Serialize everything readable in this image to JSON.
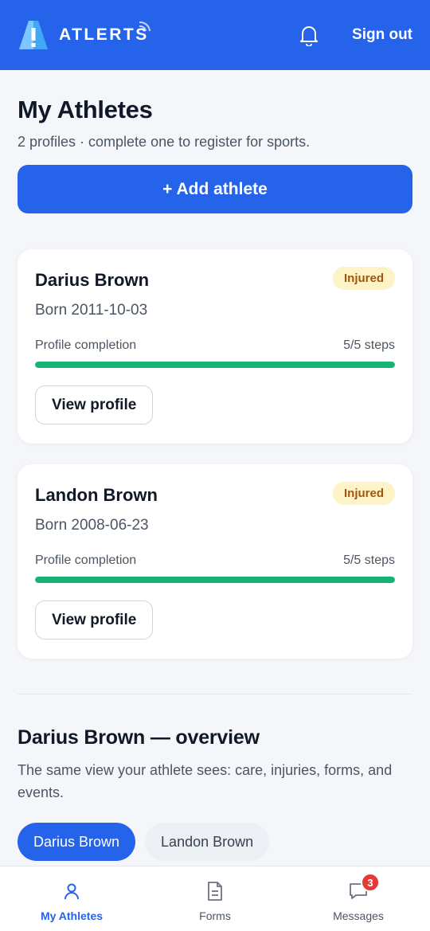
{
  "header": {
    "brand": "ATLERTS",
    "logo_icon": "atlerts-logo-icon",
    "bell_icon": "bell-icon",
    "sign_out": "Sign out"
  },
  "page": {
    "title": "My Athletes",
    "subtitle": "2 profiles · complete one to register for sports.",
    "add_button": "+ Add athlete"
  },
  "athletes": [
    {
      "name": "Darius Brown",
      "status": "Injured",
      "born": "Born 2011-10-03",
      "progress_label": "Profile completion",
      "progress_value": "5/5 steps",
      "progress_fraction": 1.0,
      "view_button": "View profile"
    },
    {
      "name": "Landon Brown",
      "status": "Injured",
      "born": "Born 2008-06-23",
      "progress_label": "Profile completion",
      "progress_value": "5/5 steps",
      "progress_fraction": 1.0,
      "view_button": "View profile"
    }
  ],
  "overview": {
    "title": "Darius Brown — overview",
    "subtitle": "The same view your athlete sees: care, injuries, forms, and events.",
    "pills": [
      "Darius Brown",
      "Landon Brown"
    ],
    "selected": "Darius Brown"
  },
  "bottom_nav": [
    {
      "label": "My Athletes",
      "icon": "person-icon",
      "active": true
    },
    {
      "label": "Forms",
      "icon": "document-icon",
      "active": false
    },
    {
      "label": "Messages",
      "icon": "chat-bubble-icon",
      "active": false,
      "badge": "3"
    }
  ],
  "colors": {
    "primary": "#2563eb",
    "progress": "#16b374",
    "badge_bg": "#fdf3c7",
    "badge_text": "#a1560c",
    "notification": "#e53935"
  }
}
